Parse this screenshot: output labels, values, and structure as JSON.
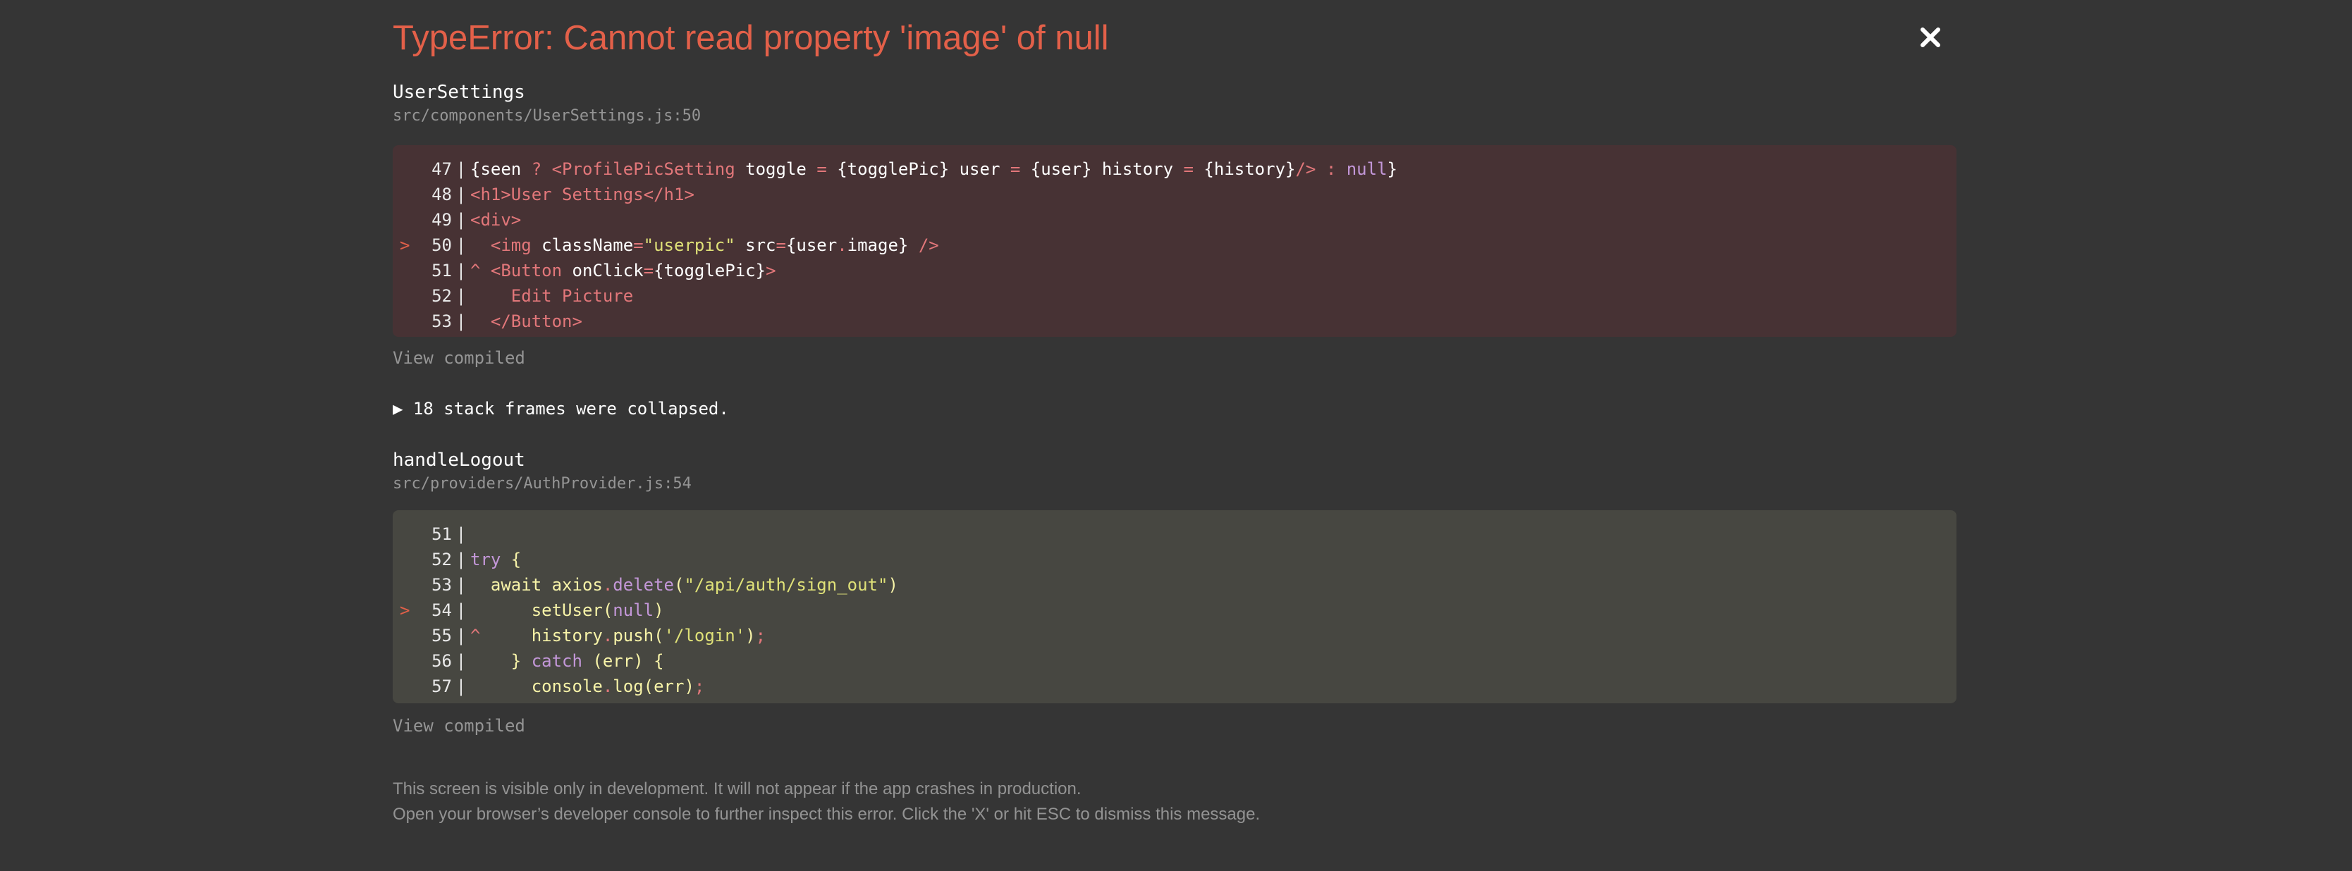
{
  "error": {
    "title": "TypeError: Cannot read property 'image' of null"
  },
  "close_icon": "close-icon",
  "frames": [
    {
      "name": "UserSettings",
      "file": "src/components/UserSettings.js:50",
      "highlight": "error",
      "view_compiled": "View compiled"
    },
    {
      "name": "handleLogout",
      "file": "src/providers/AuthProvider.js:54",
      "highlight": "neutral",
      "view_compiled": "View compiled"
    }
  ],
  "collapsed": {
    "label": "▶ 18 stack frames were collapsed."
  },
  "code1": {
    "l47": {
      "marker": "",
      "num": "47",
      "sep": "|"
    },
    "l48": {
      "marker": "",
      "num": "48",
      "sep": "|"
    },
    "l49": {
      "marker": "",
      "num": "49",
      "sep": "|"
    },
    "l50": {
      "marker": ">",
      "num": "50",
      "sep": "|"
    },
    "l51": {
      "marker": "",
      "num": "51",
      "sep": "|"
    },
    "l52": {
      "marker": "",
      "num": "52",
      "sep": "|"
    },
    "l53": {
      "marker": "",
      "num": "53",
      "sep": "|"
    }
  },
  "code2": {
    "l51": {
      "marker": "",
      "num": "51",
      "sep": "|"
    },
    "l52": {
      "marker": "",
      "num": "52",
      "sep": "|"
    },
    "l53": {
      "marker": "",
      "num": "53",
      "sep": "|"
    },
    "l54": {
      "marker": ">",
      "num": "54",
      "sep": "|"
    },
    "l55": {
      "marker": "",
      "num": "55",
      "sep": "|"
    },
    "l56": {
      "marker": "",
      "num": "56",
      "sep": "|"
    },
    "l57": {
      "marker": "",
      "num": "57",
      "sep": "|"
    }
  },
  "tokens1": {
    "a": "{seen ",
    "b": "? ",
    "c": "<ProfilePicSetting ",
    "d": "toggle ",
    "e": "= ",
    "f": "{togglePic} ",
    "g": "user ",
    "h": "= ",
    "i": "{user} ",
    "j": "history ",
    "k": "= ",
    "l": "{history}",
    "m": "/> ",
    "n": ": ",
    "o": "null",
    "p": "}",
    "q": "<h1>",
    "r": "User Settings",
    "s": "</h1>",
    "t": "<div>",
    "u": "  <img ",
    "v": "className",
    "w": "=",
    "x": "\"userpic\"",
    "y": " src",
    "z": "=",
    "aa": "{user",
    "ab": ".",
    "ac": "image} ",
    "ad": "/>",
    "ae": "^ ",
    "af": "<Button ",
    "ag": "onClick",
    "ah": "=",
    "ai": "{togglePic}",
    "aj": ">",
    "ak": "    Edit Picture",
    "al": "  </Button>"
  },
  "tokens2": {
    "a": "try ",
    "b": "{",
    "c": "  await ",
    "d": "axios",
    "e": ".",
    "f": "delete",
    "g": "(",
    "h": "\"/api/auth/sign_out\"",
    "i": ")",
    "j": "      setUser",
    "k": "(",
    "l": "null",
    "m": ")",
    "n": "^ ",
    "o": "    history",
    "p": ".",
    "q": "push",
    "r": "(",
    "s": "'/login'",
    "t": ")",
    "u": ";",
    "v": "    } ",
    "w": "catch ",
    "x": "(err) ",
    "y": "{",
    "z": "      console",
    "aa": ".",
    "ab": "log",
    "ac": "(err)",
    "ad": ";"
  },
  "footer": {
    "line1": "This screen is visible only in development. It will not appear if the app crashes in production.",
    "line2": "Open your browser’s developer console to further inspect this error.  Click the 'X' or hit ESC to dismiss this message."
  },
  "colors": {
    "background": "#353535",
    "error_title": "#e36049",
    "error_code_bg": "#473234",
    "neutral_code_bg": "#474741"
  }
}
